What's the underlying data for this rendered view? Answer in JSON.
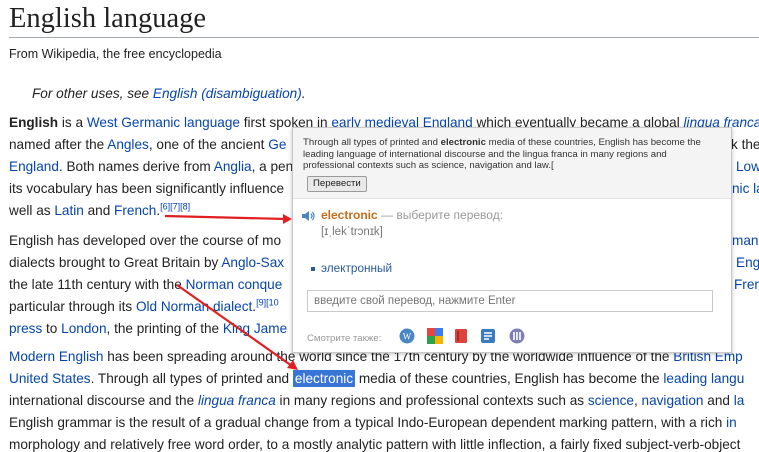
{
  "article": {
    "title": "English language",
    "tagline": "From Wikipedia, the free encyclopedia",
    "hatnote": {
      "prefix": "For other uses, see ",
      "link": "English (disambiguation)",
      "suffix": "."
    },
    "lines": {
      "l1": {
        "b": "English",
        "t1": " is a ",
        "a1": "West Germanic language",
        "t2": " first spoken in ",
        "a2": "early medieval England",
        "t3": " which eventually became a global ",
        "a3": "lingua franca"
      },
      "l2": {
        "t1": "named after the ",
        "a1": "Angles",
        "t2": ", one of the ancient ",
        "a2": "Ge",
        "tr": "k their"
      },
      "l3": {
        "a1": "England",
        "t1": ". Both names derive from ",
        "a2": "Anglia",
        "t2": ", a pen",
        "tr": "Low"
      },
      "l4": {
        "t1": "its vocabulary has been significantly influence",
        "tr": "nic la"
      },
      "l5": {
        "t1": "well as ",
        "a1": "Latin",
        "t2": " and ",
        "a2": "French",
        "t3": ".",
        "s": "[6][7][8]"
      },
      "l6": {
        "t1": "English has developed over the course of mo",
        "tr": "mani"
      },
      "l7": {
        "t1": "dialects brought to Great Britain by ",
        "a1": "Anglo-Sax",
        "tr": "Eng"
      },
      "l8": {
        "t1": "the late 11th century with the ",
        "a1": "Norman conque",
        "tr": "Fren"
      },
      "l9": {
        "t1": "particular through its ",
        "a1": "Old Norman dialect",
        "t2": ".",
        "s": "[9][10"
      },
      "l10": {
        "a1": "press",
        "t1": " to ",
        "a2": "London",
        "t2": ", the printing of the ",
        "a3": "King Jame"
      },
      "l11": {
        "a1": "Modern English",
        "t1": " has been spreading around the world since the 17th century by the worldwide influence of the ",
        "a2": "British Emp"
      },
      "l12": {
        "a1": "United States",
        "t1": ". Through all types of printed and ",
        "hl": "electronic",
        "t2": " media of these countries, English has become the ",
        "a2": "leading langu"
      },
      "l13": {
        "t1": "international discourse and the ",
        "a1": "lingua franca",
        "t2": " in many regions and professional contexts such as ",
        "a2": "science",
        "t3": ", ",
        "a3": "navigation",
        "t4": " and ",
        "a4": "la"
      },
      "l14": {
        "t1": "English grammar is the result of a gradual change from a typical Indo-European dependent marking pattern, with a rich ",
        "a1": "in"
      },
      "l15": {
        "t1": "morphology and relatively free word order, to a mostly analytic pattern with little inflection, a fairly fixed subject-verb-object"
      }
    }
  },
  "popup": {
    "context": {
      "part1": "Through all types of printed and ",
      "word": "electronic",
      "part2": " media of these countries, English has become the leading language of international discourse and the lingua franca in many regions and professional contexts such as science, navigation and law.[",
      "button": "Перевести"
    },
    "word": "electronic",
    "hint": " — выберите перевод:",
    "transcription": "[ɪˌlekˈtrɔnɪk]",
    "option": "электронный",
    "input_placeholder": "введите свой перевод, нажмите Enter",
    "see_also": "Смотрите также:",
    "icons": [
      "wikipedia-icon",
      "google-icon",
      "dictionary-icon",
      "thesaurus-icon",
      "multitran-icon"
    ]
  },
  "colors": {
    "link": "#0645ad",
    "highlight": "#3875d7",
    "arrow": "#e02020",
    "word": "#c86d19"
  }
}
